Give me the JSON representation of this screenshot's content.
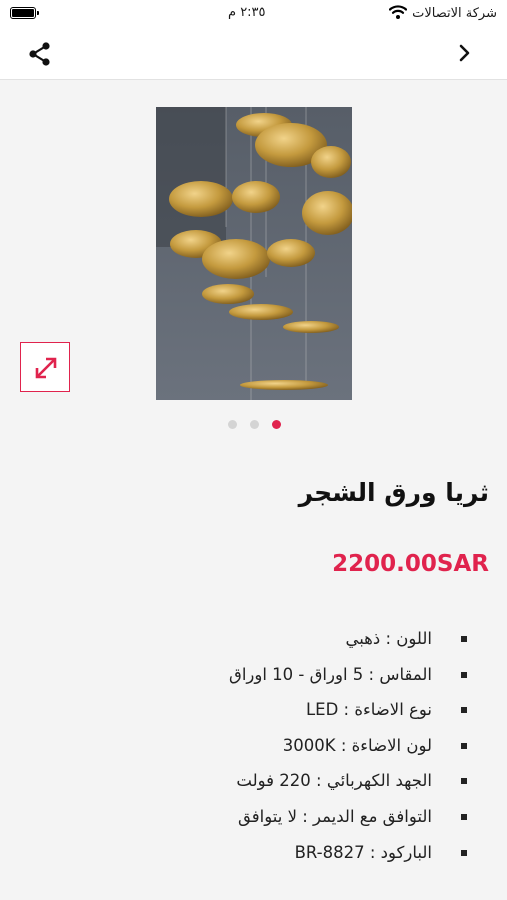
{
  "status_bar": {
    "carrier": "شركة الاتصالات",
    "time": "٢:٣٥ م"
  },
  "nav": {
    "share_icon": "share-icon",
    "back_icon": "chevron-right-icon"
  },
  "product": {
    "image_alt": "product-photo",
    "carousel": {
      "count": 3,
      "active_index": 2
    },
    "title": "ثريا ورق الشجر",
    "price": "2200.00SAR",
    "specs": [
      "اللون : ذهبي",
      "المقاس : 5 اوراق - 10 اوراق",
      "نوع الاضاءة : LED",
      "لون الاضاءة : 3000K",
      "الجهد الكهربائي : 220 فولت",
      "التوافق مع الديمر : لا يتوافق",
      "الباركود : BR-8827"
    ]
  },
  "colors": {
    "accent": "#e0234d",
    "background": "#f4f4f4"
  }
}
